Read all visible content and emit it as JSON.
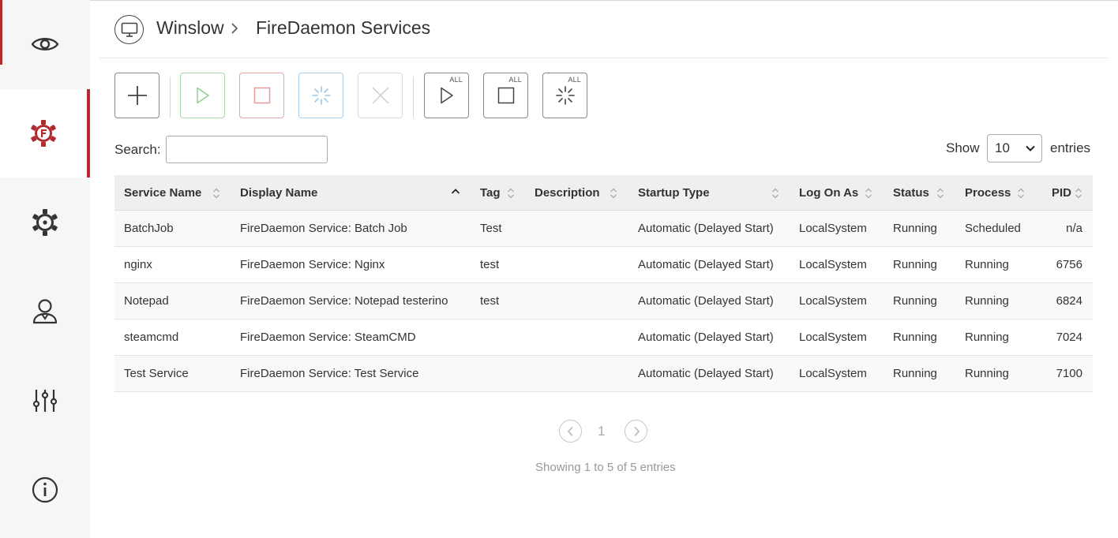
{
  "sidebar": {
    "items": [
      {
        "name": "eye-icon"
      },
      {
        "name": "firedaemon-icon"
      },
      {
        "name": "gear-icon"
      },
      {
        "name": "user-icon"
      },
      {
        "name": "sliders-icon"
      },
      {
        "name": "info-icon"
      }
    ],
    "active_index": 1,
    "accent_color": "#b02a2e"
  },
  "header": {
    "breadcrumb": [
      "Winslow",
      "FireDaemon Services"
    ]
  },
  "toolbar": {
    "all_badge": "ALL",
    "buttons": [
      "add",
      "start",
      "stop",
      "restart",
      "delete",
      "start-all",
      "stop-all",
      "restart-all"
    ]
  },
  "search": {
    "label": "Search:",
    "value": ""
  },
  "length": {
    "show_label": "Show",
    "selected": "10",
    "entries_label": "entries"
  },
  "table": {
    "columns": [
      "Service Name",
      "Display Name",
      "Tag",
      "Description",
      "Startup Type",
      "Log On As",
      "Status",
      "Process",
      "PID"
    ],
    "sorted_column": "Display Name",
    "sort_direction": "ascending",
    "rows": [
      [
        "BatchJob",
        "FireDaemon Service: Batch Job",
        "Test",
        "",
        "Automatic (Delayed Start)",
        "LocalSystem",
        "Running",
        "Scheduled",
        "n/a"
      ],
      [
        "nginx",
        "FireDaemon Service: Nginx",
        "test",
        "",
        "Automatic (Delayed Start)",
        "LocalSystem",
        "Running",
        "Running",
        "6756"
      ],
      [
        "Notepad",
        "FireDaemon Service: Notepad testerino",
        "test",
        "",
        "Automatic (Delayed Start)",
        "LocalSystem",
        "Running",
        "Running",
        "6824"
      ],
      [
        "steamcmd",
        "FireDaemon Service: SteamCMD",
        "",
        "",
        "Automatic (Delayed Start)",
        "LocalSystem",
        "Running",
        "Running",
        "7024"
      ],
      [
        "Test Service",
        "FireDaemon Service: Test Service",
        "",
        "",
        "Automatic (Delayed Start)",
        "LocalSystem",
        "Running",
        "Running",
        "7100"
      ]
    ]
  },
  "pagination": {
    "current_page": "1",
    "info": "Showing 1 to 5 of 5 entries"
  }
}
